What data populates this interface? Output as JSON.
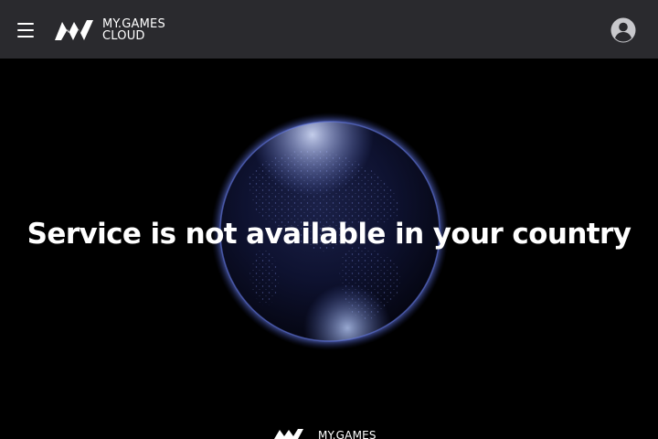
{
  "header": {
    "menu_icon": "hamburger-menu-icon",
    "logo": {
      "line1": "MY.GAMES",
      "line2": "CLOUD"
    },
    "profile_icon": "user-avatar-icon"
  },
  "main": {
    "message": "Service is not available in your country",
    "background_icon": "earth-globe-at-night"
  },
  "footer": {
    "logo_text": "MY.GAMES"
  },
  "colors": {
    "header_bg": "#2a2a2e",
    "page_bg": "#000000",
    "text": "#ffffff",
    "profile_icon": "#c8c8cc"
  }
}
